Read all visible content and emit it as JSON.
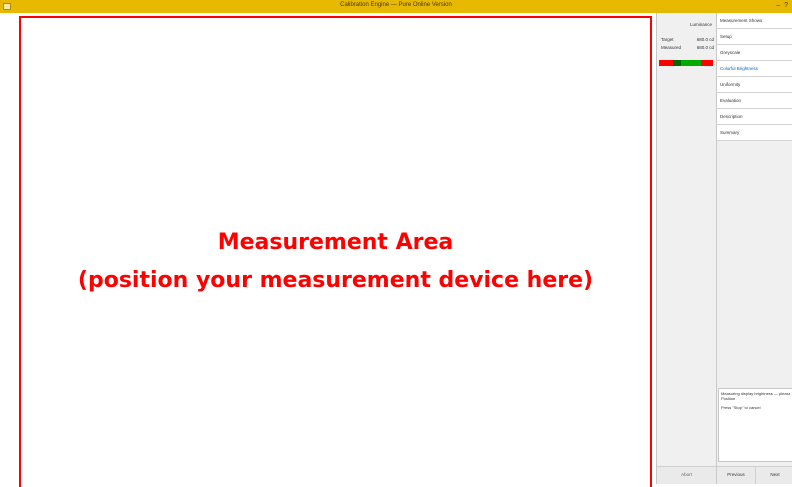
{
  "window": {
    "title": "Calibration Engine — Pure Online Version",
    "controls": [
      "–",
      "?"
    ],
    "accent": "#e6b800"
  },
  "measurement_area": {
    "line1": "Measurement Area",
    "line2": "(position your measurement device here)",
    "color": "#ff0000"
  },
  "left_panel": {
    "header_label": "Luminance",
    "rows": [
      {
        "label": "Target",
        "value": "680.0 cd",
        "unit": "cd/m²"
      },
      {
        "label": "Measured",
        "value": "680.0 cd",
        "unit": "cd/m²"
      }
    ],
    "status_colors": [
      "#ff0000",
      "#006600",
      "#00aa00",
      "#ff0000"
    ],
    "footer_button": "Abort"
  },
  "nav": {
    "items": [
      {
        "label": "Measurement Shows"
      },
      {
        "label": "Setup"
      },
      {
        "label": "Greyscale"
      },
      {
        "label": "Colorful Brightness"
      },
      {
        "label": "Uniformity"
      },
      {
        "label": "Evaluation"
      },
      {
        "label": "Description"
      },
      {
        "label": "Summary"
      }
    ],
    "active_index": 3
  },
  "message": {
    "line1": "Measuring display brightness — please wait",
    "line2": "Position",
    "line3": "Press \"Stop\" to cancel"
  },
  "footer": {
    "btn1": "Previous",
    "btn2": "Next"
  }
}
